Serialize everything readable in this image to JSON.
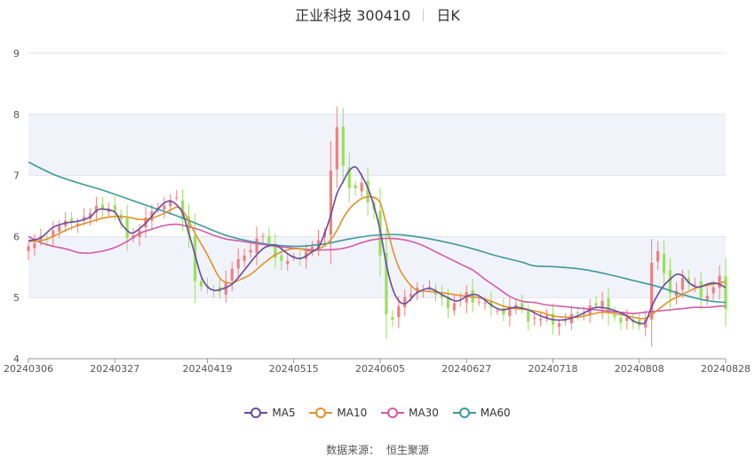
{
  "header": {
    "stock_name": "正业科技 300410",
    "period": "日K"
  },
  "source_label": "数据来源：",
  "source_name": "恒生聚源",
  "colors": {
    "up": "#f08080",
    "down": "#98e05a",
    "ma5": "#6a4a9f",
    "ma10": "#e0922c",
    "ma30": "#d45ca8",
    "ma60": "#3d9a9a",
    "band": "#f1f3fb"
  },
  "chart_data": {
    "type": "candlestick",
    "title": "正业科技 300410 日K",
    "ylim": [
      4,
      9
    ],
    "yticks": [
      "4",
      "5",
      "6",
      "7",
      "8",
      "9"
    ],
    "xticks": [
      "20240306",
      "20240327",
      "20240419",
      "20240515",
      "20240605",
      "20240627",
      "20240718",
      "20240808",
      "20240828"
    ],
    "xtick_index": [
      0,
      14,
      29,
      43,
      57,
      71,
      85,
      99,
      113
    ],
    "n_bars": 114,
    "legend": [
      {
        "key": "ma5",
        "label": "MA5"
      },
      {
        "key": "ma10",
        "label": "MA10"
      },
      {
        "key": "ma30",
        "label": "MA30"
      },
      {
        "key": "ma60",
        "label": "MA60"
      }
    ],
    "close_anchors": [
      [
        0,
        5.8
      ],
      [
        2,
        5.95
      ],
      [
        4,
        6.12
      ],
      [
        6,
        6.2
      ],
      [
        8,
        6.28
      ],
      [
        10,
        6.35
      ],
      [
        12,
        6.52
      ],
      [
        14,
        6.42
      ],
      [
        15,
        6.18
      ],
      [
        16,
        6.0
      ],
      [
        17,
        6.05
      ],
      [
        19,
        6.25
      ],
      [
        21,
        6.48
      ],
      [
        23,
        6.62
      ],
      [
        24,
        6.55
      ],
      [
        26,
        6.05
      ],
      [
        27,
        5.35
      ],
      [
        28,
        5.1
      ],
      [
        29,
        5.15
      ],
      [
        30,
        5.1
      ],
      [
        32,
        5.25
      ],
      [
        34,
        5.6
      ],
      [
        36,
        5.85
      ],
      [
        38,
        5.98
      ],
      [
        40,
        5.75
      ],
      [
        41,
        5.58
      ],
      [
        43,
        5.6
      ],
      [
        45,
        5.78
      ],
      [
        47,
        5.88
      ],
      [
        48,
        6.05
      ],
      [
        49,
        7.15
      ],
      [
        50,
        7.8
      ],
      [
        51,
        7.15
      ],
      [
        52,
        6.7
      ],
      [
        53,
        6.85
      ],
      [
        54,
        6.9
      ],
      [
        55,
        6.6
      ],
      [
        56,
        6.35
      ],
      [
        57,
        5.7
      ],
      [
        58,
        4.75
      ],
      [
        59,
        4.7
      ],
      [
        61,
        4.95
      ],
      [
        63,
        5.2
      ],
      [
        65,
        5.1
      ],
      [
        67,
        5.0
      ],
      [
        69,
        4.85
      ],
      [
        71,
        5.05
      ],
      [
        73,
        4.95
      ],
      [
        75,
        4.8
      ],
      [
        77,
        4.8
      ],
      [
        79,
        4.85
      ],
      [
        81,
        4.7
      ],
      [
        83,
        4.65
      ],
      [
        85,
        4.6
      ],
      [
        87,
        4.65
      ],
      [
        89,
        4.7
      ],
      [
        91,
        4.9
      ],
      [
        93,
        4.85
      ],
      [
        95,
        4.7
      ],
      [
        97,
        4.6
      ],
      [
        99,
        4.55
      ],
      [
        100,
        4.7
      ],
      [
        101,
        5.55
      ],
      [
        102,
        5.7
      ],
      [
        104,
        5.1
      ],
      [
        106,
        5.25
      ],
      [
        108,
        5.2
      ],
      [
        110,
        5.0
      ],
      [
        112,
        5.3
      ],
      [
        113,
        4.88
      ]
    ],
    "series": [
      {
        "name": "MA5",
        "key": "ma5",
        "points": [
          [
            0,
            5.93
          ],
          [
            2,
            5.98
          ],
          [
            4,
            6.15
          ],
          [
            6,
            6.22
          ],
          [
            8,
            6.25
          ],
          [
            10,
            6.32
          ],
          [
            11,
            6.42
          ],
          [
            12,
            6.45
          ],
          [
            14,
            6.4
          ],
          [
            15,
            6.22
          ],
          [
            16,
            6.1
          ],
          [
            17,
            6.06
          ],
          [
            19,
            6.22
          ],
          [
            21,
            6.45
          ],
          [
            22,
            6.55
          ],
          [
            23,
            6.58
          ],
          [
            24,
            6.52
          ],
          [
            25,
            6.38
          ],
          [
            26,
            6.05
          ],
          [
            27,
            5.7
          ],
          [
            28,
            5.35
          ],
          [
            29,
            5.18
          ],
          [
            30,
            5.12
          ],
          [
            31,
            5.13
          ],
          [
            33,
            5.22
          ],
          [
            35,
            5.45
          ],
          [
            36,
            5.58
          ],
          [
            37,
            5.7
          ],
          [
            38,
            5.8
          ],
          [
            39,
            5.85
          ],
          [
            40,
            5.86
          ],
          [
            41,
            5.8
          ],
          [
            42,
            5.72
          ],
          [
            43,
            5.66
          ],
          [
            44,
            5.64
          ],
          [
            45,
            5.68
          ],
          [
            46,
            5.75
          ],
          [
            47,
            5.82
          ],
          [
            48,
            6.05
          ],
          [
            49,
            6.35
          ],
          [
            50,
            6.7
          ],
          [
            51,
            6.9
          ],
          [
            52,
            7.08
          ],
          [
            53,
            7.14
          ],
          [
            54,
            7.0
          ],
          [
            55,
            6.8
          ],
          [
            56,
            6.5
          ],
          [
            57,
            6.1
          ],
          [
            58,
            5.55
          ],
          [
            59,
            5.15
          ],
          [
            60,
            4.95
          ],
          [
            61,
            4.9
          ],
          [
            62,
            4.98
          ],
          [
            63,
            5.08
          ],
          [
            65,
            5.15
          ],
          [
            67,
            5.05
          ],
          [
            69,
            4.95
          ],
          [
            70,
            4.96
          ],
          [
            71,
            5.02
          ],
          [
            72,
            5.05
          ],
          [
            73,
            5.03
          ],
          [
            75,
            4.88
          ],
          [
            76,
            4.82
          ],
          [
            77,
            4.8
          ],
          [
            79,
            4.84
          ],
          [
            81,
            4.8
          ],
          [
            83,
            4.7
          ],
          [
            85,
            4.64
          ],
          [
            87,
            4.64
          ],
          [
            89,
            4.7
          ],
          [
            91,
            4.8
          ],
          [
            92,
            4.84
          ],
          [
            94,
            4.82
          ],
          [
            96,
            4.75
          ],
          [
            97,
            4.7
          ],
          [
            98,
            4.62
          ],
          [
            99,
            4.58
          ],
          [
            100,
            4.6
          ],
          [
            101,
            4.85
          ],
          [
            102,
            5.05
          ],
          [
            103,
            5.2
          ],
          [
            104,
            5.3
          ],
          [
            105,
            5.38
          ],
          [
            106,
            5.36
          ],
          [
            107,
            5.25
          ],
          [
            108,
            5.18
          ],
          [
            109,
            5.18
          ],
          [
            110,
            5.22
          ],
          [
            111,
            5.24
          ],
          [
            112,
            5.22
          ],
          [
            113,
            5.16
          ]
        ]
      },
      {
        "name": "MA10",
        "key": "ma10",
        "points": [
          [
            0,
            5.92
          ],
          [
            2,
            5.93
          ],
          [
            4,
            6.0
          ],
          [
            6,
            6.1
          ],
          [
            8,
            6.18
          ],
          [
            10,
            6.24
          ],
          [
            12,
            6.3
          ],
          [
            14,
            6.33
          ],
          [
            16,
            6.32
          ],
          [
            18,
            6.28
          ],
          [
            20,
            6.3
          ],
          [
            22,
            6.38
          ],
          [
            24,
            6.48
          ],
          [
            25,
            6.42
          ],
          [
            26,
            6.25
          ],
          [
            27,
            6.05
          ],
          [
            28,
            5.88
          ],
          [
            29,
            5.7
          ],
          [
            30,
            5.5
          ],
          [
            31,
            5.32
          ],
          [
            32,
            5.25
          ],
          [
            33,
            5.24
          ],
          [
            34,
            5.28
          ],
          [
            36,
            5.38
          ],
          [
            38,
            5.55
          ],
          [
            40,
            5.7
          ],
          [
            42,
            5.78
          ],
          [
            43,
            5.8
          ],
          [
            44,
            5.8
          ],
          [
            46,
            5.76
          ],
          [
            48,
            5.85
          ],
          [
            49,
            5.95
          ],
          [
            50,
            6.1
          ],
          [
            51,
            6.3
          ],
          [
            52,
            6.45
          ],
          [
            53,
            6.55
          ],
          [
            54,
            6.62
          ],
          [
            55,
            6.65
          ],
          [
            56,
            6.64
          ],
          [
            57,
            6.55
          ],
          [
            58,
            6.2
          ],
          [
            59,
            5.8
          ],
          [
            60,
            5.5
          ],
          [
            61,
            5.32
          ],
          [
            62,
            5.2
          ],
          [
            63,
            5.12
          ],
          [
            65,
            5.1
          ],
          [
            67,
            5.08
          ],
          [
            69,
            5.05
          ],
          [
            71,
            5.02
          ],
          [
            73,
            5.0
          ],
          [
            75,
            4.94
          ],
          [
            77,
            4.86
          ],
          [
            79,
            4.82
          ],
          [
            81,
            4.8
          ],
          [
            83,
            4.76
          ],
          [
            85,
            4.7
          ],
          [
            87,
            4.68
          ],
          [
            89,
            4.68
          ],
          [
            91,
            4.72
          ],
          [
            93,
            4.76
          ],
          [
            95,
            4.74
          ],
          [
            97,
            4.7
          ],
          [
            99,
            4.66
          ],
          [
            100,
            4.66
          ],
          [
            101,
            4.72
          ],
          [
            102,
            4.8
          ],
          [
            104,
            4.95
          ],
          [
            106,
            5.05
          ],
          [
            108,
            5.15
          ],
          [
            110,
            5.2
          ],
          [
            112,
            5.24
          ],
          [
            113,
            5.26
          ]
        ]
      },
      {
        "name": "MA30",
        "key": "ma30",
        "points": [
          [
            0,
            6.0
          ],
          [
            2,
            5.9
          ],
          [
            4,
            5.84
          ],
          [
            6,
            5.8
          ],
          [
            8,
            5.74
          ],
          [
            9,
            5.73
          ],
          [
            10,
            5.73
          ],
          [
            12,
            5.76
          ],
          [
            14,
            5.82
          ],
          [
            16,
            5.92
          ],
          [
            18,
            6.05
          ],
          [
            20,
            6.12
          ],
          [
            22,
            6.18
          ],
          [
            24,
            6.2
          ],
          [
            26,
            6.16
          ],
          [
            28,
            6.1
          ],
          [
            30,
            6.02
          ],
          [
            32,
            5.96
          ],
          [
            34,
            5.93
          ],
          [
            36,
            5.9
          ],
          [
            38,
            5.87
          ],
          [
            40,
            5.84
          ],
          [
            42,
            5.82
          ],
          [
            44,
            5.8
          ],
          [
            46,
            5.78
          ],
          [
            48,
            5.78
          ],
          [
            50,
            5.79
          ],
          [
            52,
            5.83
          ],
          [
            54,
            5.9
          ],
          [
            56,
            5.95
          ],
          [
            58,
            5.97
          ],
          [
            60,
            5.96
          ],
          [
            62,
            5.92
          ],
          [
            64,
            5.85
          ],
          [
            66,
            5.75
          ],
          [
            68,
            5.65
          ],
          [
            70,
            5.55
          ],
          [
            72,
            5.45
          ],
          [
            74,
            5.3
          ],
          [
            76,
            5.16
          ],
          [
            78,
            5.02
          ],
          [
            80,
            4.94
          ],
          [
            82,
            4.92
          ],
          [
            84,
            4.88
          ],
          [
            86,
            4.86
          ],
          [
            88,
            4.84
          ],
          [
            90,
            4.82
          ],
          [
            92,
            4.8
          ],
          [
            94,
            4.78
          ],
          [
            96,
            4.76
          ],
          [
            98,
            4.74
          ],
          [
            100,
            4.76
          ],
          [
            102,
            4.78
          ],
          [
            104,
            4.8
          ],
          [
            106,
            4.82
          ],
          [
            108,
            4.84
          ],
          [
            110,
            4.84
          ],
          [
            112,
            4.86
          ],
          [
            113,
            4.86
          ]
        ]
      },
      {
        "name": "MA60",
        "key": "ma60",
        "points": [
          [
            0,
            7.22
          ],
          [
            4,
            7.02
          ],
          [
            8,
            6.88
          ],
          [
            12,
            6.76
          ],
          [
            16,
            6.62
          ],
          [
            20,
            6.48
          ],
          [
            24,
            6.34
          ],
          [
            28,
            6.18
          ],
          [
            32,
            6.02
          ],
          [
            36,
            5.92
          ],
          [
            40,
            5.86
          ],
          [
            44,
            5.84
          ],
          [
            48,
            5.88
          ],
          [
            52,
            5.96
          ],
          [
            56,
            6.02
          ],
          [
            60,
            6.03
          ],
          [
            64,
            5.98
          ],
          [
            68,
            5.9
          ],
          [
            72,
            5.8
          ],
          [
            76,
            5.68
          ],
          [
            80,
            5.58
          ],
          [
            82,
            5.52
          ],
          [
            86,
            5.5
          ],
          [
            90,
            5.46
          ],
          [
            94,
            5.38
          ],
          [
            98,
            5.28
          ],
          [
            102,
            5.18
          ],
          [
            106,
            5.05
          ],
          [
            110,
            4.95
          ],
          [
            113,
            4.92
          ]
        ]
      }
    ]
  }
}
